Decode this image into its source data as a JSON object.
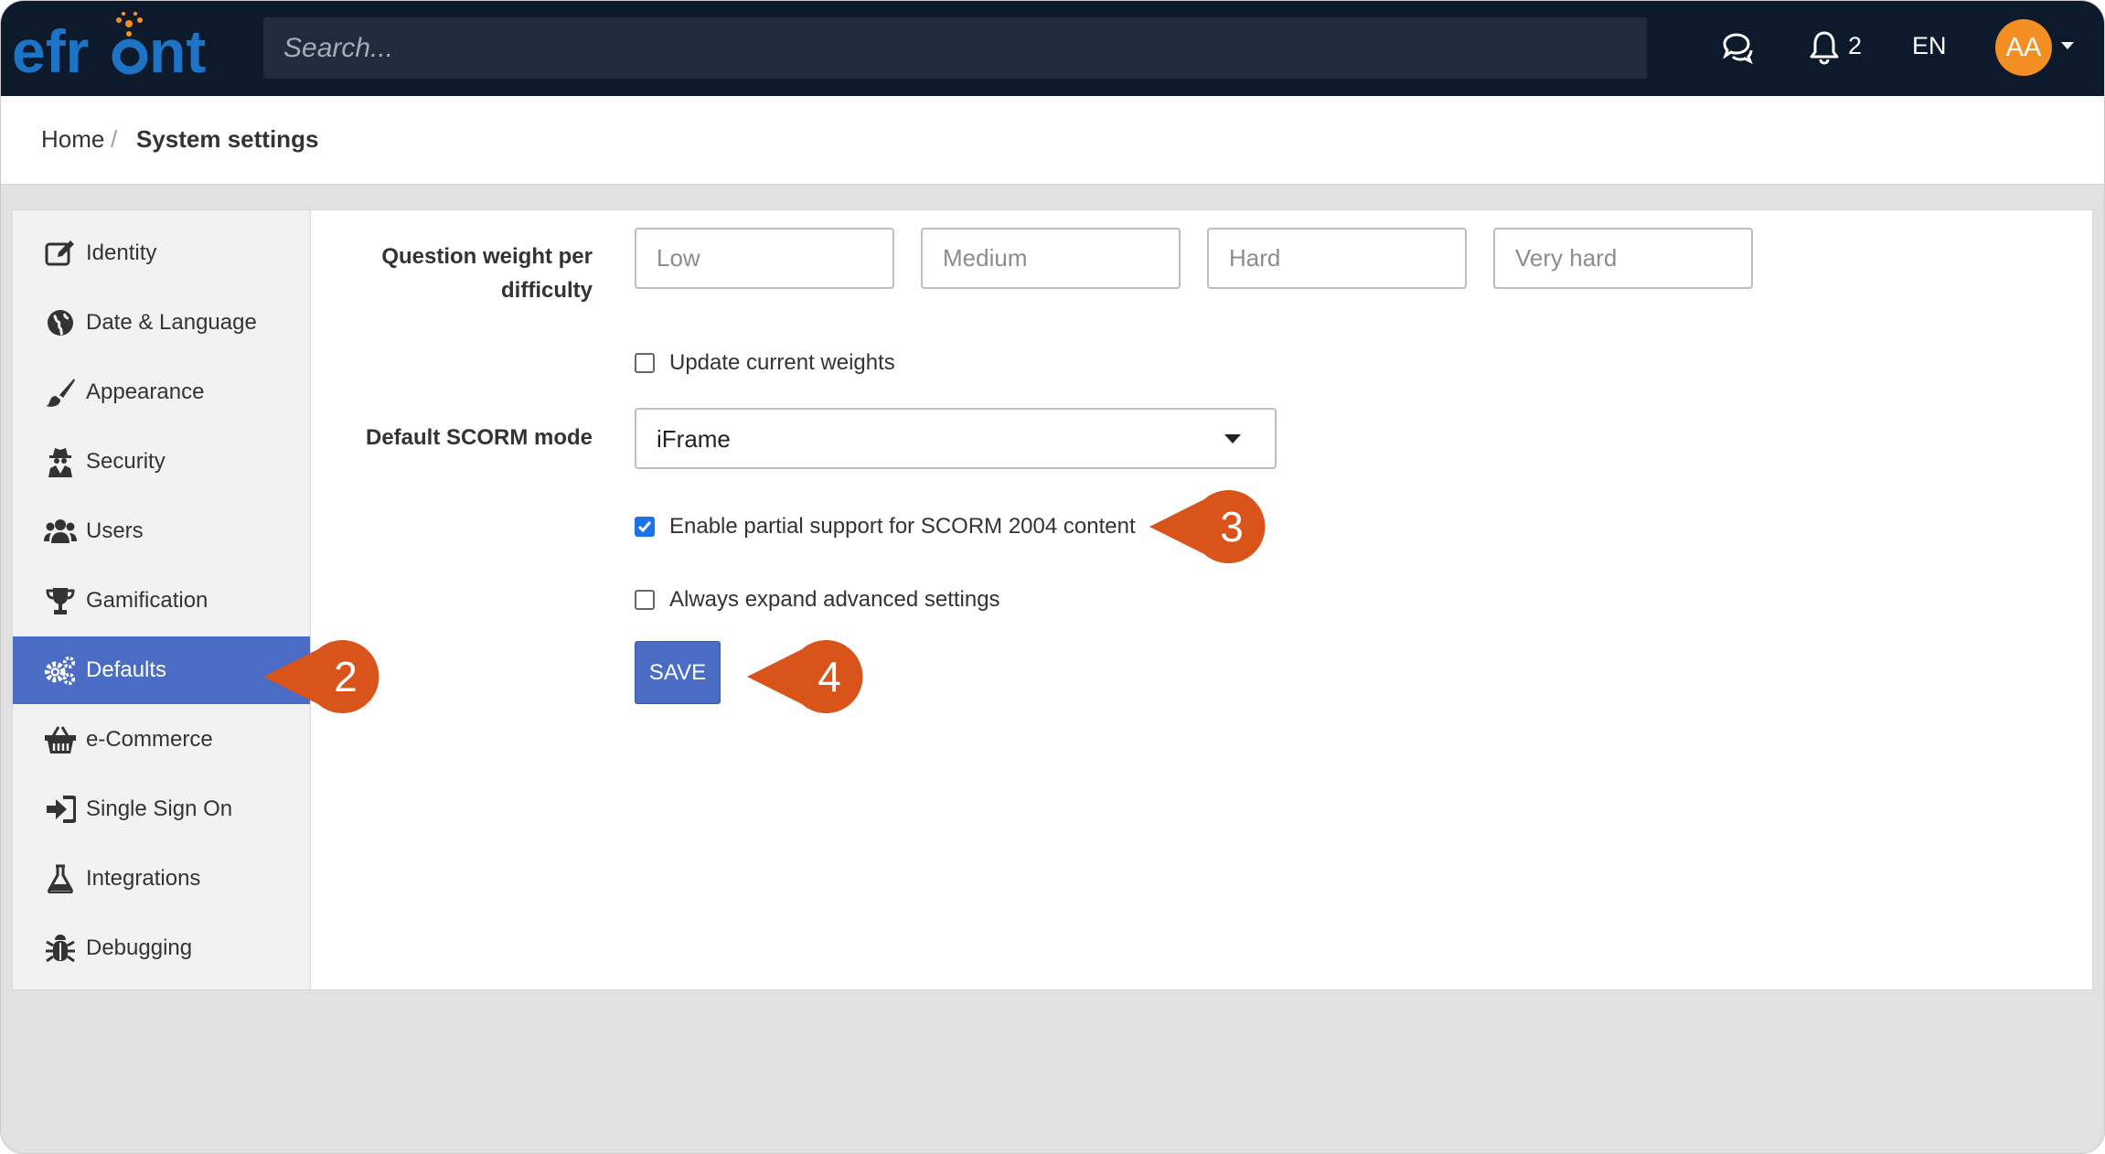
{
  "app": {
    "logo_text": "efront",
    "search_placeholder": "Search...",
    "notifications_count": "2",
    "language": "EN",
    "avatar_initials": "AA",
    "colors": {
      "topbar": "#0d1a2b",
      "accent": "#4a6cc4",
      "callout": "#d9541a",
      "logo_blue": "#1d74c7",
      "logo_orange": "#f28e22"
    }
  },
  "breadcrumb": {
    "home": "Home",
    "separator": "/",
    "current": "System settings"
  },
  "sidebar": {
    "items": [
      {
        "label": "Identity",
        "icon": "edit-icon"
      },
      {
        "label": "Date & Language",
        "icon": "globe-icon"
      },
      {
        "label": "Appearance",
        "icon": "paintbrush-icon"
      },
      {
        "label": "Security",
        "icon": "spy-icon"
      },
      {
        "label": "Users",
        "icon": "users-icon"
      },
      {
        "label": "Gamification",
        "icon": "trophy-icon"
      },
      {
        "label": "Defaults",
        "icon": "cogs-icon",
        "active": true
      },
      {
        "label": "e-Commerce",
        "icon": "basket-icon"
      },
      {
        "label": "Single Sign On",
        "icon": "sign-in-icon"
      },
      {
        "label": "Integrations",
        "icon": "flask-icon"
      },
      {
        "label": "Debugging",
        "icon": "bug-icon"
      }
    ]
  },
  "form": {
    "question_weight_label_line1": "Question weight per",
    "question_weight_label_line2": "difficulty",
    "weights": [
      {
        "placeholder": "Low",
        "value": ""
      },
      {
        "placeholder": "Medium",
        "value": ""
      },
      {
        "placeholder": "Hard",
        "value": ""
      },
      {
        "placeholder": "Very hard",
        "value": ""
      }
    ],
    "update_weights_label": "Update current weights",
    "update_weights_checked": false,
    "scorm_mode_label": "Default SCORM mode",
    "scorm_mode_value": "iFrame",
    "scorm2004_label": "Enable partial support for SCORM 2004 content",
    "scorm2004_checked": true,
    "expand_advanced_label": "Always expand advanced settings",
    "expand_advanced_checked": false,
    "save_label": "SAVE"
  },
  "callouts": [
    {
      "number": "2",
      "target": "Defaults"
    },
    {
      "number": "3",
      "target": "Enable partial support for SCORM 2004 content"
    },
    {
      "number": "4",
      "target": "SAVE"
    }
  ]
}
